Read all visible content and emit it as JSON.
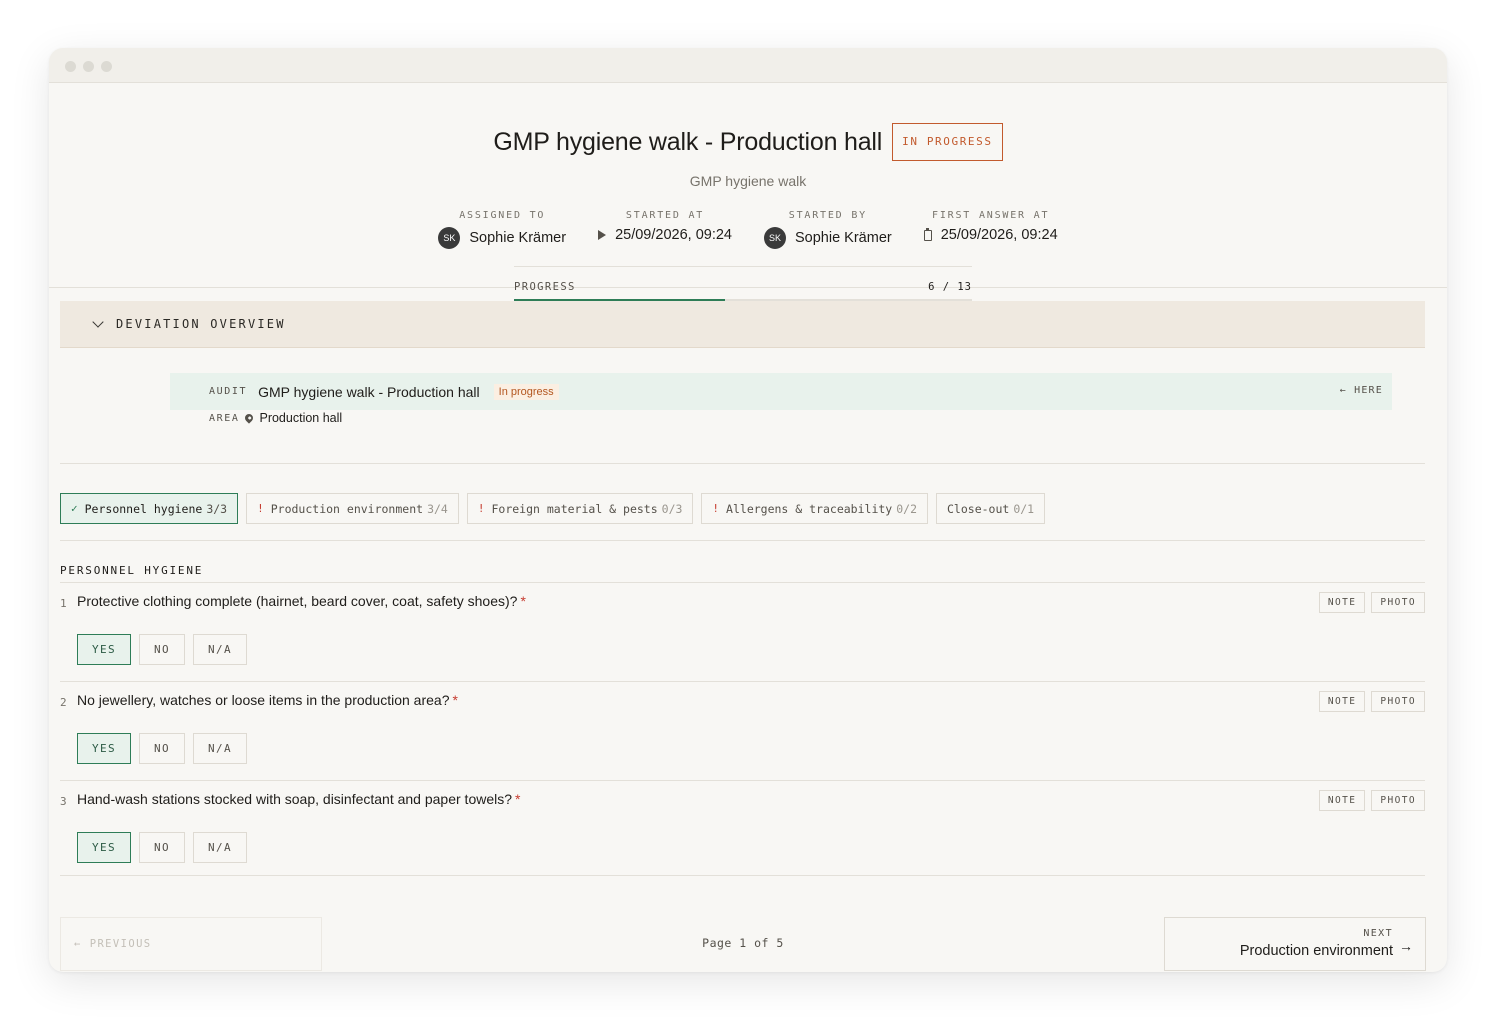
{
  "header": {
    "title": "GMP hygiene walk - Production hall",
    "status": "IN PROGRESS",
    "subtitle": "GMP hygiene walk",
    "meta": [
      {
        "label": "ASSIGNED TO",
        "avatar": "SK",
        "value": "Sophie Krämer"
      },
      {
        "label": "STARTED AT",
        "icon": "play-icon",
        "value": "25/09/2026, 09:24"
      },
      {
        "label": "STARTED BY",
        "avatar": "SK",
        "value": "Sophie Krämer"
      },
      {
        "label": "FIRST ANSWER AT",
        "icon": "clipboard-icon",
        "value": "25/09/2026, 09:24"
      }
    ],
    "progress": {
      "label": "PROGRESS",
      "count_text": "6 / 13",
      "answered": 6,
      "total": 13
    }
  },
  "deviation": {
    "label": "DEVIATION OVERVIEW"
  },
  "audit": {
    "tag": "AUDIT",
    "name": "GMP hygiene walk - Production hall",
    "status": "In progress",
    "here": "← HERE",
    "area_tag": "AREA",
    "area_name": "Production hall"
  },
  "tabs": [
    {
      "mark": "✓",
      "label": "Personnel hygiene",
      "count": "3/3",
      "active": true
    },
    {
      "mark": "!",
      "label": "Production environment",
      "count": "3/4",
      "active": false
    },
    {
      "mark": "!",
      "label": "Foreign material & pests",
      "count": "0/3",
      "active": false
    },
    {
      "mark": "!",
      "label": "Allergens & traceability",
      "count": "0/2",
      "active": false
    },
    {
      "mark": "",
      "label": "Close-out",
      "count": "0/1",
      "active": false
    }
  ],
  "section": {
    "title": "PERSONNEL HYGIENE"
  },
  "questions": [
    {
      "num": "1",
      "text": "Protective clothing complete (hairnet, beard cover, coat, safety shoes)?",
      "required": "*",
      "answer": "YES"
    },
    {
      "num": "2",
      "text": "No jewellery, watches or loose items in the production area?",
      "required": "*",
      "answer": "YES"
    },
    {
      "num": "3",
      "text": "Hand-wash stations stocked with soap, disinfectant and paper towels?",
      "required": "*",
      "answer": "YES"
    }
  ],
  "labels": {
    "note": "NOTE",
    "photo": "PHOTO",
    "yes": "YES",
    "no": "NO",
    "na": "N/A"
  },
  "footer": {
    "previous": "PREVIOUS",
    "prev_arrow": "←",
    "page": "Page 1 of 5",
    "next_label": "NEXT",
    "next_target": "Production environment",
    "next_arrow": "→"
  },
  "colors": {
    "accent": "#2e7d57",
    "status": "#c25a2d",
    "warning": "#c63b2f"
  }
}
